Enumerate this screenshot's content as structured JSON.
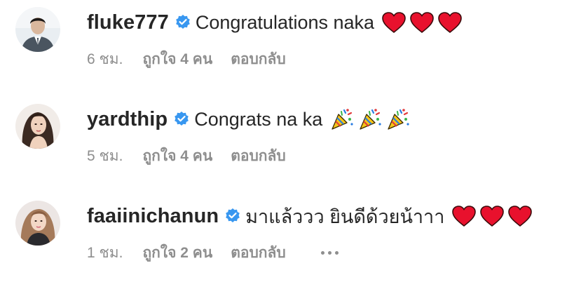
{
  "comments": [
    {
      "username": "fluke777",
      "text": "Congratulations naka",
      "emoji": "heart",
      "emoji_count": 3,
      "time": "6 ชม.",
      "likes": "ถูกใจ 4 คน",
      "reply": "ตอบกลับ",
      "avatar_icon": "avatar-man-suit"
    },
    {
      "username": "yardthip",
      "text": "Congrats na ka",
      "emoji": "party-popper",
      "emoji_count": 3,
      "time": "5 ชม.",
      "likes": "ถูกใจ 4 คน",
      "reply": "ตอบกลับ",
      "avatar_icon": "avatar-woman-dark-hair"
    },
    {
      "username": "faaiinichanun",
      "text": "มาแล้ววว ยินดีด้วยน้าาา",
      "emoji": "heart",
      "emoji_count": 3,
      "time": "1 ชม.",
      "likes": "ถูกใจ 2 คน",
      "reply": "ตอบกลับ",
      "avatar_icon": "avatar-woman-light-hair"
    }
  ],
  "colors": {
    "username": "#262626",
    "meta": "#8e8e8e",
    "verified": "#3897f0",
    "heart": "#e8112d"
  }
}
